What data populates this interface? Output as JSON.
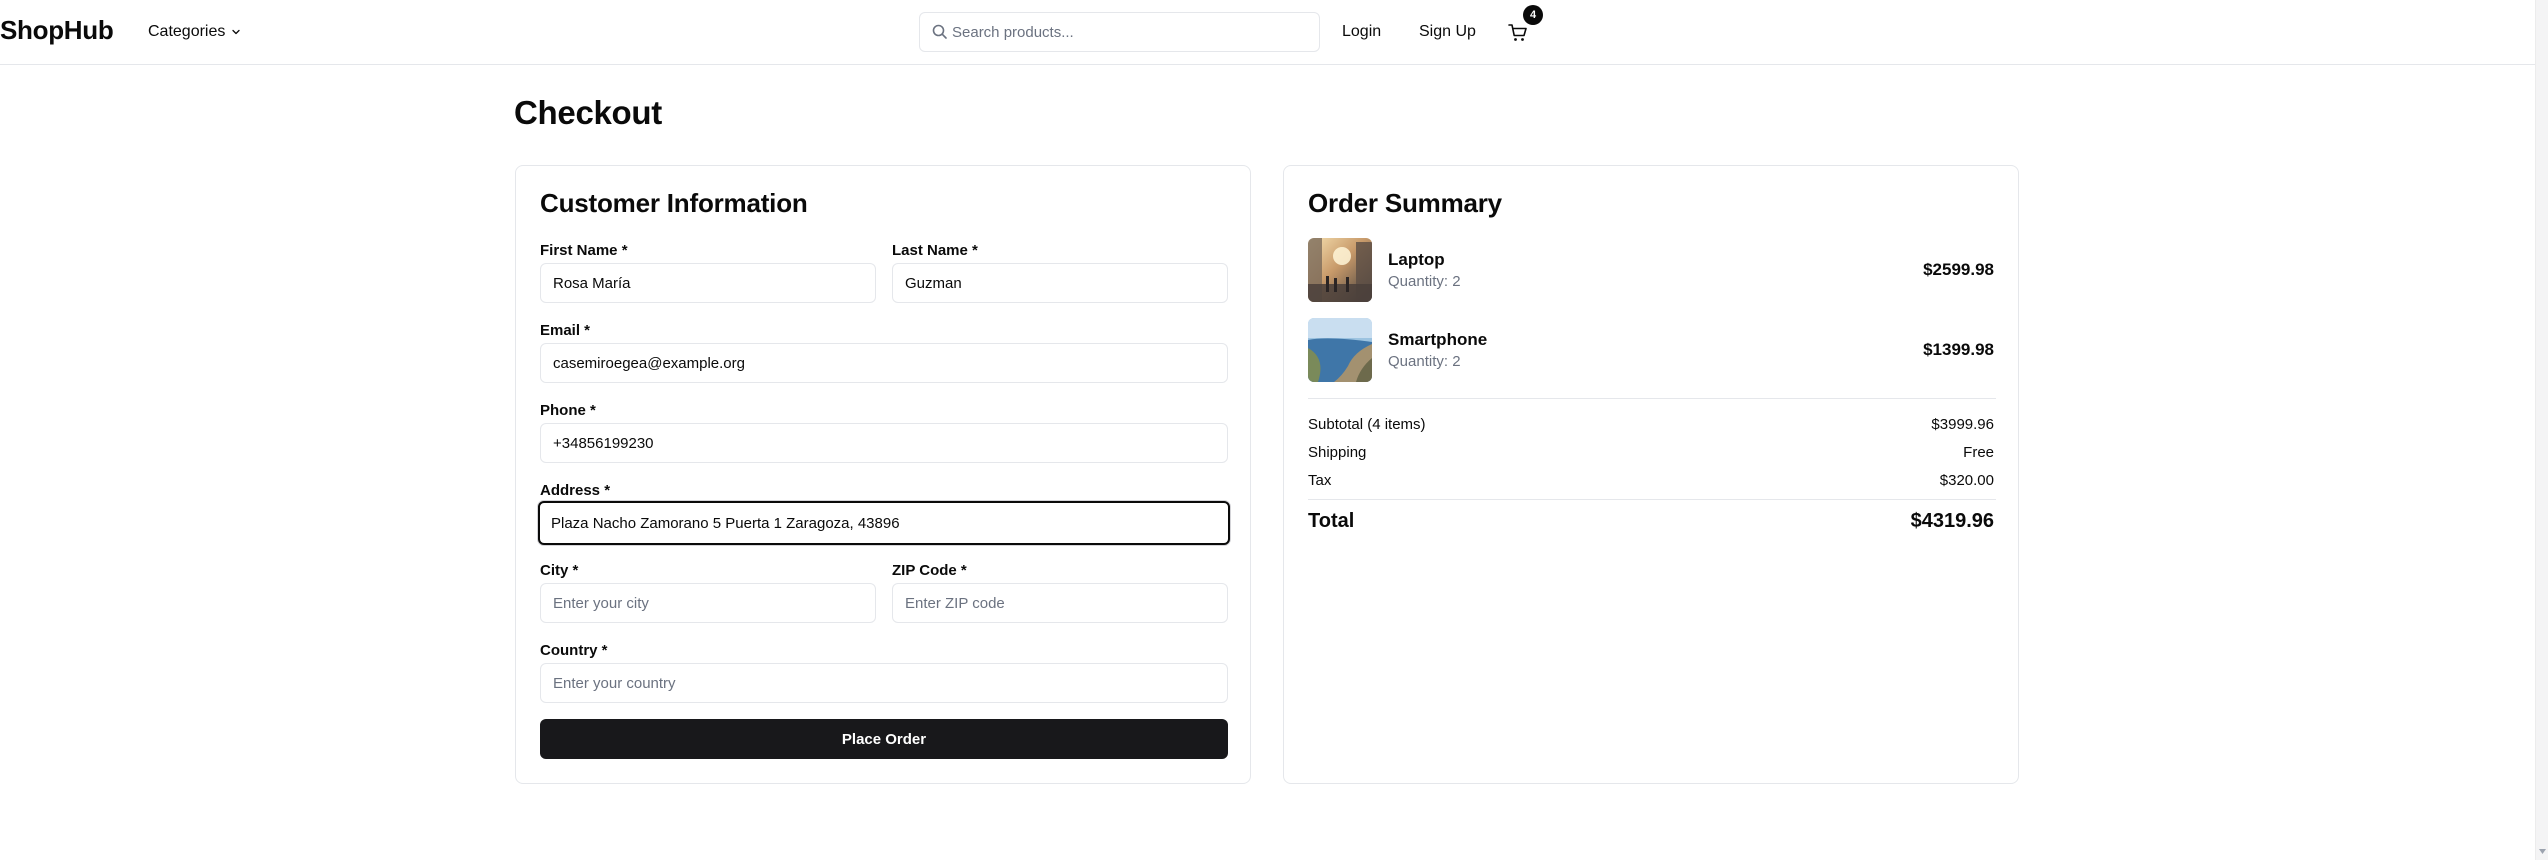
{
  "header": {
    "logo": "ShopHub",
    "categories_label": "Categories",
    "search_placeholder": "Search products...",
    "login_label": "Login",
    "signup_label": "Sign Up",
    "cart_count": "4",
    "icons": [
      "chevron-down-icon",
      "search-icon",
      "shopping-cart-icon"
    ]
  },
  "page": {
    "title": "Checkout"
  },
  "customer_form": {
    "title": "Customer Information",
    "first_name": {
      "label": "First Name *",
      "value": "Rosa María",
      "placeholder": ""
    },
    "last_name": {
      "label": "Last Name *",
      "value": "Guzman",
      "placeholder": ""
    },
    "email": {
      "label": "Email *",
      "value": "casemiroegea@example.org",
      "placeholder": ""
    },
    "phone": {
      "label": "Phone *",
      "value": "+34856199230",
      "placeholder": ""
    },
    "address": {
      "label": "Address *",
      "value": "Plaza Nacho Zamorano 5 Puerta 1 Zaragoza, 43896",
      "placeholder": ""
    },
    "city": {
      "label": "City *",
      "value": "",
      "placeholder": "Enter your city"
    },
    "zip": {
      "label": "ZIP Code *",
      "value": "",
      "placeholder": "Enter ZIP code"
    },
    "country": {
      "label": "Country *",
      "value": "",
      "placeholder": "Enter your country"
    },
    "submit_label": "Place Order"
  },
  "order_summary": {
    "title": "Order Summary",
    "items": [
      {
        "name": "Laptop",
        "quantity": "Quantity: 2",
        "price": "$2599.98"
      },
      {
        "name": "Smartphone",
        "quantity": "Quantity: 2",
        "price": "$1399.98"
      }
    ],
    "subtotal_label": "Subtotal (4 items)",
    "subtotal_value": "$3999.96",
    "shipping_label": "Shipping",
    "shipping_value": "Free",
    "tax_label": "Tax",
    "tax_value": "$320.00",
    "total_label": "Total",
    "total_value": "$4319.96"
  },
  "colors": {
    "primary_button": "#18181b",
    "border": "#e5e7eb",
    "muted_text": "#6b7280"
  }
}
